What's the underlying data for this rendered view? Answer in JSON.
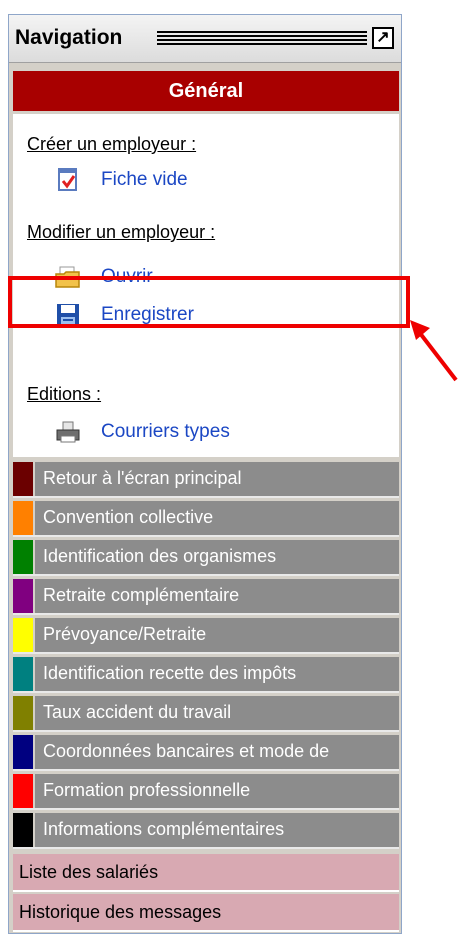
{
  "panel": {
    "title": "Navigation",
    "pin_icon": "pin-icon",
    "pin_glyph": "↗"
  },
  "general": {
    "header": "Général",
    "sections": [
      {
        "label": "Créer un employeur :",
        "actions": [
          {
            "label": "Fiche vide",
            "icon": "blank-form-icon"
          }
        ]
      },
      {
        "label": "Modifier un employeur :",
        "actions": [
          {
            "label": "Ouvrir",
            "icon": "open-folder-icon"
          },
          {
            "label": "Enregistrer",
            "icon": "save-icon"
          }
        ]
      },
      {
        "label": "Editions :",
        "actions": [
          {
            "label": "Courriers types",
            "icon": "printer-icon"
          }
        ]
      }
    ]
  },
  "nav_items": [
    {
      "label": "Retour à l'écran principal",
      "color": "#6b0000"
    },
    {
      "label": "Convention collective",
      "color": "#ff8000"
    },
    {
      "label": "Identification des organismes",
      "color": "#008000"
    },
    {
      "label": "Retraite complémentaire",
      "color": "#800080"
    },
    {
      "label": "Prévoyance/Retraite",
      "color": "#ffff00"
    },
    {
      "label": "Identification recette des impôts",
      "color": "#008080"
    },
    {
      "label": "Taux accident du travail",
      "color": "#808000"
    },
    {
      "label": "Coordonnées bancaires et mode de",
      "color": "#000080"
    },
    {
      "label": "Formation professionnelle",
      "color": "#ff0000"
    },
    {
      "label": "Informations complémentaires",
      "color": "#000000"
    }
  ],
  "bottom_items": [
    {
      "label": "Liste des salariés"
    },
    {
      "label": "Historique des messages"
    }
  ],
  "colors": {
    "general_header": "#a80000",
    "link": "#1b47c4",
    "highlight": "#ee0000",
    "bottom_item_bg": "#d8a9b2"
  }
}
